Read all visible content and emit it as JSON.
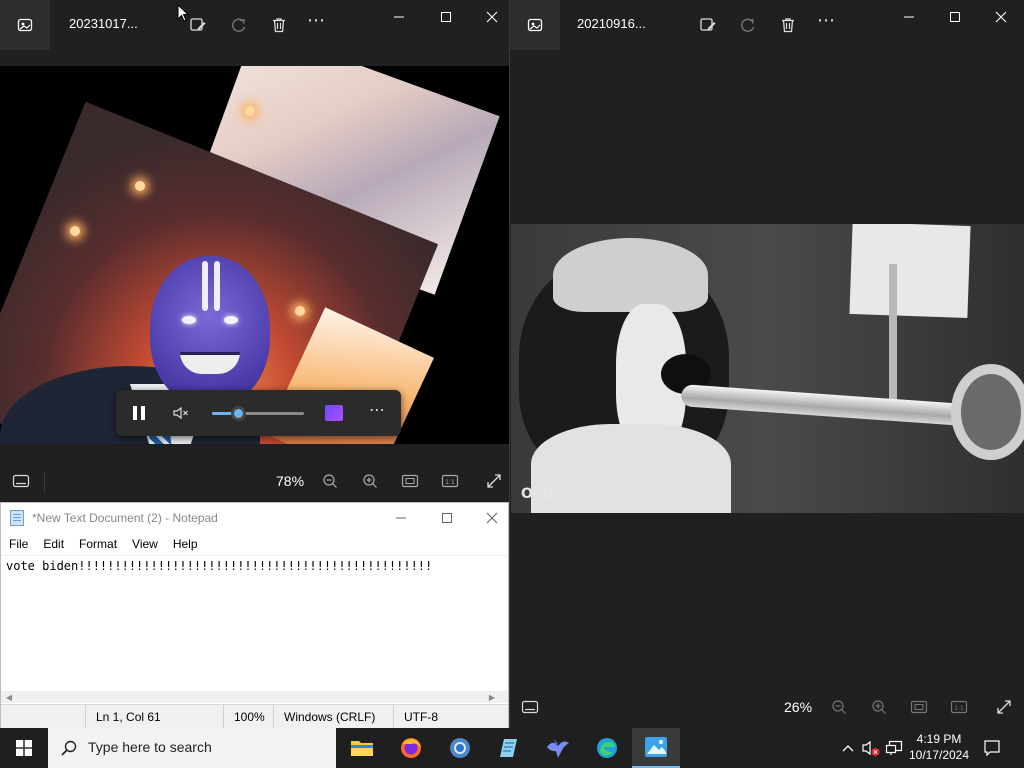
{
  "photos_left": {
    "filename": "20231017...",
    "zoom": "78%",
    "media": {
      "volume_fraction": 0.28
    }
  },
  "photos_right": {
    "filename": "20210916...",
    "zoom": "26%",
    "watermark": "OoJi"
  },
  "notepad": {
    "title": "*New Text Document (2) - Notepad",
    "menu": [
      "File",
      "Edit",
      "Format",
      "View",
      "Help"
    ],
    "content": "vote biden!!!!!!!!!!!!!!!!!!!!!!!!!!!!!!!!!!!!!!!!!!!!!!!!!",
    "status": {
      "position": "Ln 1, Col 61",
      "zoom": "100%",
      "line_ending": "Windows (CRLF)",
      "encoding": "UTF-8"
    }
  },
  "taskbar": {
    "search_placeholder": "Type here to search",
    "time": "4:19 PM",
    "date": "10/17/2024",
    "apps": [
      "file-explorer",
      "firefox",
      "chrome",
      "notepad",
      "bird-app",
      "edge",
      "photos"
    ]
  },
  "colors": {
    "accent": "#76b9ed",
    "slider": "#6cb3f2",
    "window_bg": "#202020"
  }
}
